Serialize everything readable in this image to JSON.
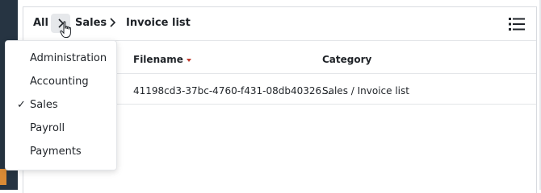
{
  "breadcrumb": {
    "items": [
      "All",
      "Sales",
      "Invoice list"
    ]
  },
  "table": {
    "columns": [
      "Filename",
      "Category"
    ],
    "rows": [
      {
        "filename": "41198cd3-37bc-4760-f431-08db40326...",
        "category": "Sales / Invoice list"
      }
    ]
  },
  "dropdown": {
    "items": [
      {
        "label": "Administration",
        "checked": false
      },
      {
        "label": "Accounting",
        "checked": false
      },
      {
        "label": "Sales",
        "checked": true
      },
      {
        "label": "Payroll",
        "checked": false
      },
      {
        "label": "Payments",
        "checked": false
      }
    ],
    "check_glyph": "✓"
  },
  "icons": {
    "separator": "chevron-right-icon",
    "view": "list-view-icon",
    "sort": "sort-descending-icon",
    "cursor": "hand-pointer-icon"
  },
  "colors": {
    "sort_indicator": "#c0392b",
    "separator_button_bg": "#e6e8eb"
  }
}
